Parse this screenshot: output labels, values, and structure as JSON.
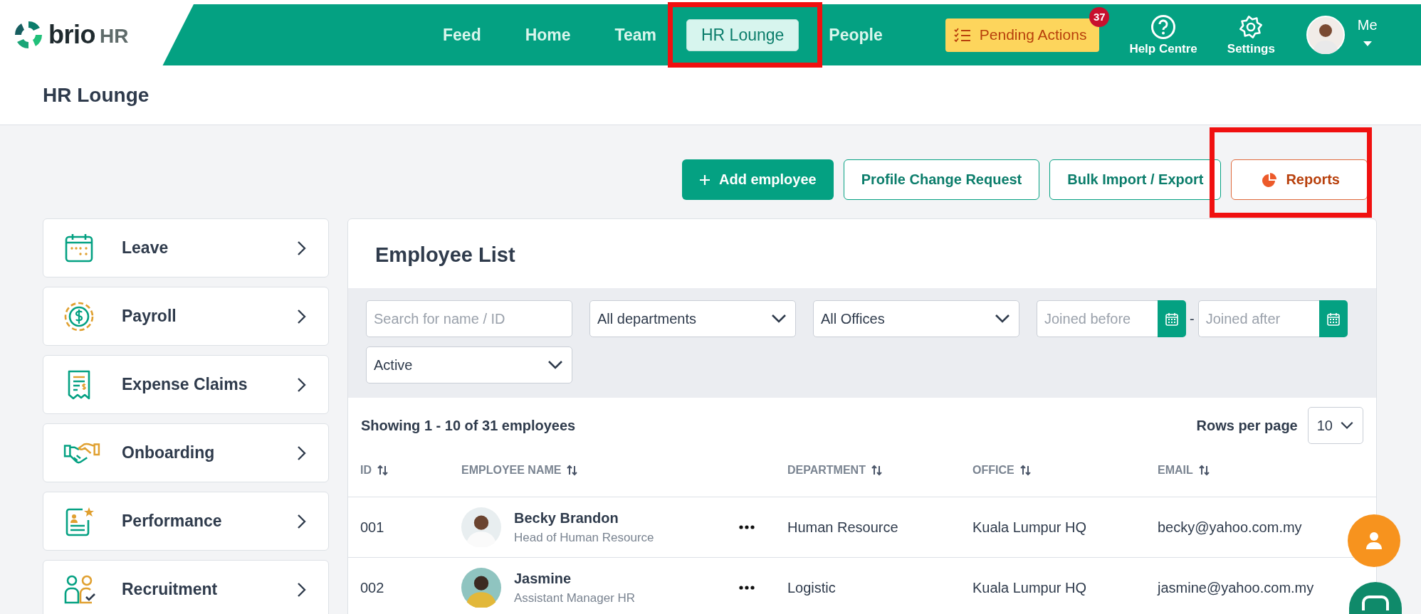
{
  "brand": {
    "name": "brio",
    "suffix": "HR"
  },
  "nav": {
    "items": [
      {
        "label": "Feed",
        "selected": false,
        "highlighted": false
      },
      {
        "label": "Home",
        "selected": false,
        "highlighted": false
      },
      {
        "label": "Team",
        "selected": false,
        "highlighted": false
      },
      {
        "label": "HR Lounge",
        "selected": true,
        "highlighted": true
      },
      {
        "label": "People",
        "selected": false,
        "highlighted": false
      }
    ],
    "pending_actions": {
      "label": "Pending Actions",
      "badge": "37"
    },
    "help": {
      "label": "Help Centre"
    },
    "settings": {
      "label": "Settings"
    },
    "user": {
      "label": "Me"
    }
  },
  "page_title": "HR Lounge",
  "actions": [
    {
      "label": "Add employee",
      "kind": "primary",
      "highlighted": false
    },
    {
      "label": "Profile Change Request",
      "kind": "outline",
      "highlighted": false
    },
    {
      "label": "Bulk Import / Export",
      "kind": "outline",
      "highlighted": false
    },
    {
      "label": "Reports",
      "kind": "report",
      "highlighted": true
    }
  ],
  "sidebar": {
    "items": [
      {
        "label": "Leave",
        "kind": "calendar"
      },
      {
        "label": "Payroll",
        "kind": "coin"
      },
      {
        "label": "Expense Claims",
        "kind": "receipt"
      },
      {
        "label": "Onboarding",
        "kind": "handshake"
      },
      {
        "label": "Performance",
        "kind": "appraisal"
      },
      {
        "label": "Recruitment",
        "kind": "people"
      }
    ]
  },
  "employee_list": {
    "title": "Employee List",
    "filters": [
      {
        "kind": "search",
        "placeholder": "Search for name / ID"
      },
      {
        "kind": "select",
        "value": "All departments"
      },
      {
        "kind": "select",
        "value": "All Offices"
      },
      {
        "kind": "date",
        "placeholder": "Joined before"
      },
      {
        "kind": "separator",
        "text": "-"
      },
      {
        "kind": "date",
        "placeholder": "Joined after"
      },
      {
        "kind": "select",
        "value": "Active"
      }
    ],
    "summary": "Showing 1 - 10 of 31 employees",
    "rows_per_page": {
      "label": "Rows per page",
      "value": "10"
    },
    "table": {
      "columns": [
        "ID",
        "EMPLOYEE NAME",
        "DEPARTMENT",
        "OFFICE",
        "EMAIL"
      ],
      "rows": [
        {
          "id": "001",
          "name": "Becky Brandon",
          "job_title": "Head of Human Resource",
          "department": "Human Resource",
          "office": "Kuala Lumpur HQ",
          "email": "becky@yahoo.com.my"
        },
        {
          "id": "002",
          "name": "Jasmine",
          "job_title": "Assistant Manager HR",
          "department": "Logistic",
          "office": "Kuala Lumpur HQ",
          "email": "jasmine@yahoo.com.my"
        }
      ]
    }
  }
}
